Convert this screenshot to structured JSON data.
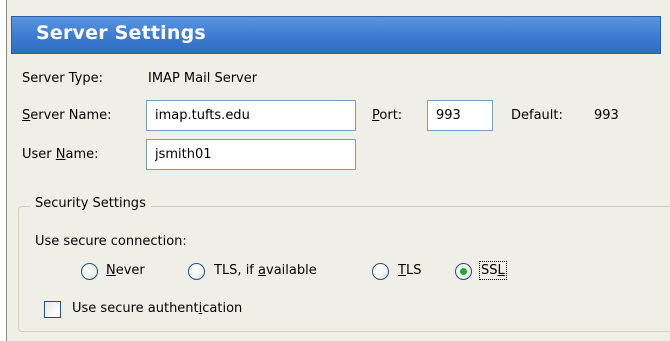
{
  "header": {
    "title": "Server Settings"
  },
  "server_type": {
    "label": "Server Type:",
    "value": "IMAP Mail Server"
  },
  "server_name": {
    "label_prefix": "",
    "label_accel": "S",
    "label_rest": "erver Name:",
    "value": "imap.tufts.edu"
  },
  "port": {
    "label_accel": "P",
    "label_rest": "ort:",
    "value": "993",
    "default_label": "Default:",
    "default_value": "993"
  },
  "user_name": {
    "label_prefix": "User ",
    "label_accel": "N",
    "label_rest": "ame:",
    "value": "jsmith01"
  },
  "security": {
    "legend": "Security Settings",
    "connection_label": "Use secure connection:",
    "options": [
      {
        "prefix": "",
        "accel": "N",
        "rest": "ever",
        "selected": false
      },
      {
        "prefix": "TLS, if ",
        "accel": "a",
        "rest": "vailable",
        "selected": false
      },
      {
        "prefix": "",
        "accel": "T",
        "rest": "LS",
        "selected": false
      },
      {
        "prefix": "SS",
        "accel": "L",
        "rest": "",
        "selected": true
      }
    ],
    "auth": {
      "prefix": "Use secure authent",
      "accel": "i",
      "rest": "cation",
      "checked": false
    }
  }
}
